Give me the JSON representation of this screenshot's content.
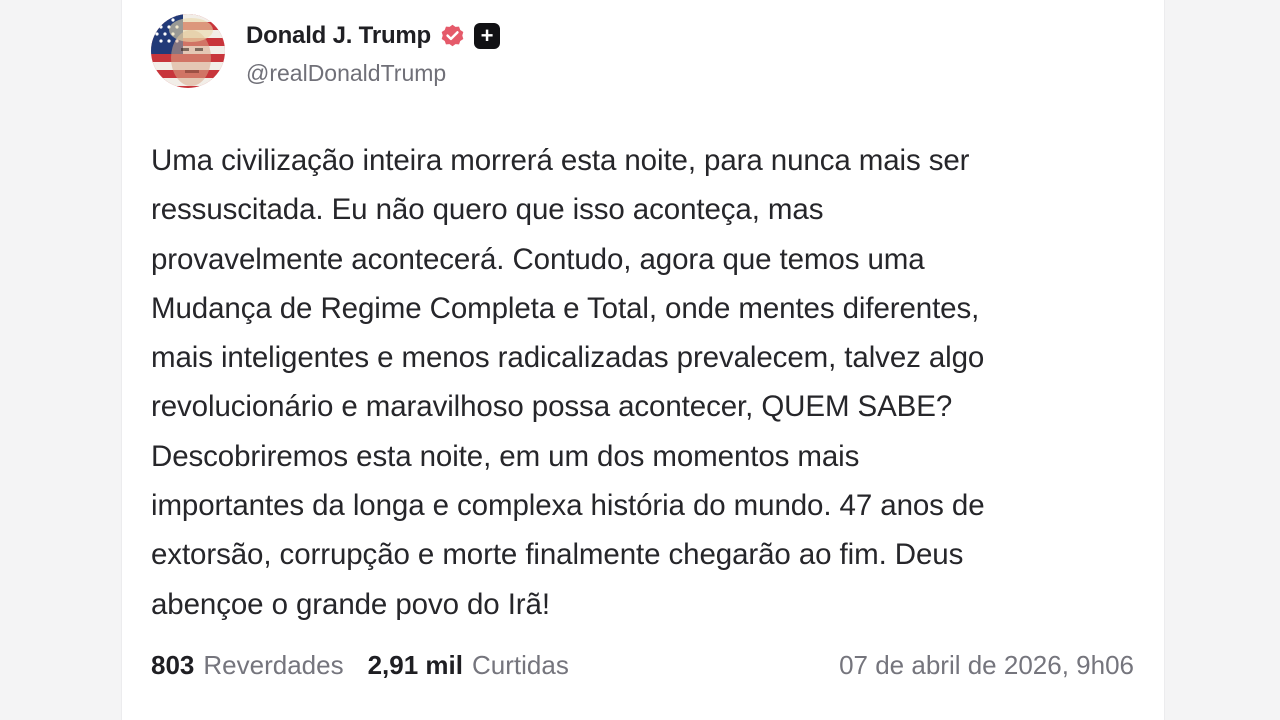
{
  "post": {
    "author": {
      "display_name": "Donald J. Trump",
      "handle": "@realDonaldTrump",
      "verified": true,
      "plus_badge": "+"
    },
    "text": "Uma civilização inteira morrerá esta noite, para nunca mais ser\nressuscitada. Eu não quero que isso aconteça, mas\nprovavelmente acontecerá. Contudo, agora que temos uma\nMudança de Regime Completa e Total, onde mentes diferentes,\nmais inteligentes e menos radicalizadas prevalecem, talvez algo\nrevolucionário e maravilhoso possa acontecer, QUEM SABE?\nDescobriremos esta noite, em um dos momentos mais\nimportantes da longa e complexa história do mundo. 47 anos de\nextorsão, corrupção e morte finalmente chegarão ao fim. Deus\nabençoe o grande povo do Irã!",
    "stats": {
      "reposts_count": "803",
      "reposts_label": "Reverdades",
      "likes_count": "2,91 mil",
      "likes_label": "Curtidas"
    },
    "timestamp": "07 de abril de 2026, 9h06"
  },
  "icons": {
    "avatar": "avatar-image",
    "verified": "verified-badge-icon",
    "plus": "plus-badge-icon"
  },
  "colors": {
    "verified_badge": "#e55a6a",
    "text": "#26262a",
    "muted": "#75757d"
  }
}
